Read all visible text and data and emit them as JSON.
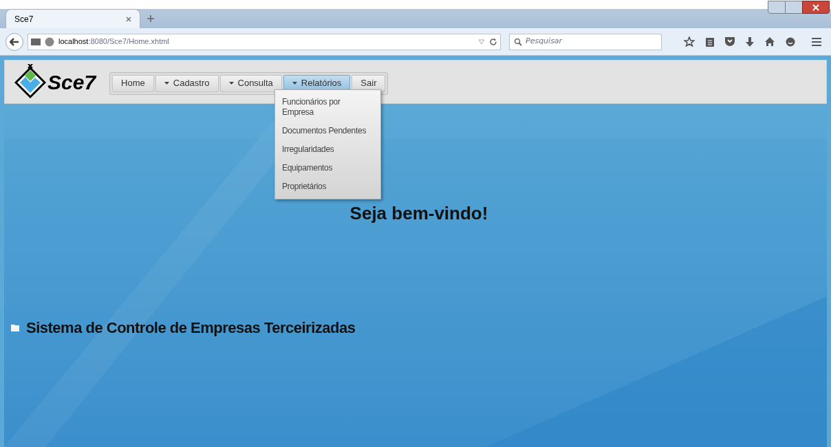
{
  "browser": {
    "tab": {
      "title": "Sce7",
      "selected": true
    },
    "address": {
      "host": "localhost",
      "path": ":8080/Sce7/Home.xhtml"
    },
    "search": {
      "placeholder": "Pesquisar"
    }
  },
  "app": {
    "logo": "Sce7",
    "menu": [
      {
        "label": "Home",
        "kind": "link",
        "selected": false
      },
      {
        "label": "Cadastro",
        "kind": "submenu",
        "selected": false
      },
      {
        "label": "Consulta",
        "kind": "submenu",
        "selected": false
      },
      {
        "label": "Relatórios",
        "kind": "submenu",
        "selected": true,
        "expanded": true,
        "items": [
          "Funcionários por Empresa",
          "Documentos Pendentes",
          "Irregularidades",
          "Equipamentos",
          "Proprietários"
        ]
      },
      {
        "label": "Sair",
        "kind": "link",
        "selected": false
      }
    ],
    "welcome": "Seja bem-vindo!",
    "system_name": "Sistema de Controle de Empresas Terceirizadas"
  }
}
